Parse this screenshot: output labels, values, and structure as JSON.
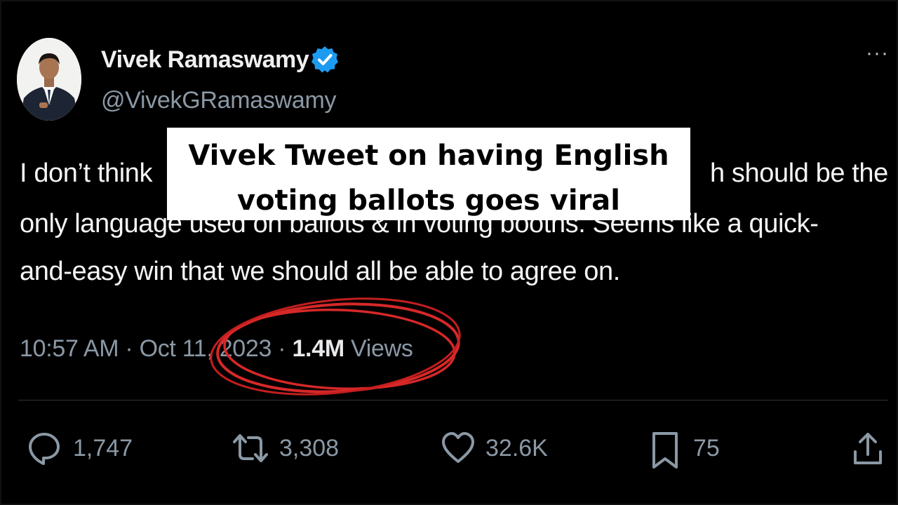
{
  "author": {
    "name": "Vivek Ramaswamy",
    "handle": "@VivekGRamaswamy",
    "verified": true,
    "verified_color": "#1d9bf0"
  },
  "more_menu": "···",
  "tweet": {
    "line1_start": "I don’t think",
    "line1_end": "h should be the",
    "line2": "only language used on ballots & in voting booths. Seems like a quick-",
    "line3": "and-easy win that we should all be able to agree on."
  },
  "overlay": {
    "line1": "Vivek Tweet on having English",
    "line2": "voting ballots goes viral"
  },
  "meta": {
    "time_date": "10:57 AM · Oct 11, 2023 · ",
    "views_count": "1.4M",
    "views_label": " Views"
  },
  "annotation_color": "#d62828",
  "actions": {
    "reply": {
      "icon": "reply-icon",
      "count": "1,747"
    },
    "retweet": {
      "icon": "retweet-icon",
      "count": "3,308"
    },
    "like": {
      "icon": "heart-icon",
      "count": "32.6K"
    },
    "bookmark": {
      "icon": "bookmark-icon",
      "count": "75"
    },
    "share": {
      "icon": "share-icon"
    }
  }
}
